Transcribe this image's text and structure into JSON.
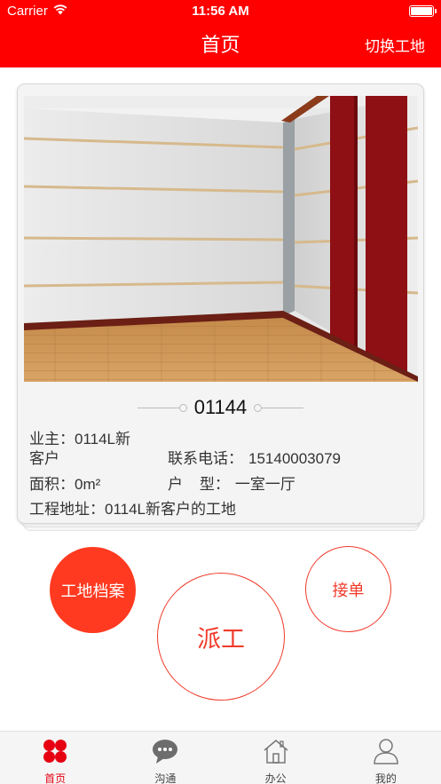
{
  "status_bar": {
    "carrier": "Carrier",
    "time": "11:56 AM"
  },
  "header": {
    "title": "首页",
    "switch_label": "切换工地"
  },
  "site": {
    "name": "01144",
    "owner_label": "业主：",
    "owner_value": "0114L新",
    "owner_value_cont": "客户",
    "phone_label": "联系电话：",
    "phone_value": "15140003079",
    "area_label": "面积：",
    "area_value": "0m²",
    "layout_label": "户    型：",
    "layout_value": "一室一厅",
    "address_label": "工程地址：",
    "address_value": "0114L新客户的工地"
  },
  "actions": {
    "archive": "工地档案",
    "dispatch": "派工",
    "accept": "接单"
  },
  "tabbar": {
    "items": [
      {
        "label": "首页",
        "icon": "home-grid-icon",
        "active": true
      },
      {
        "label": "沟通",
        "icon": "chat-bubble-icon",
        "active": false
      },
      {
        "label": "办公",
        "icon": "office-house-icon",
        "active": false
      },
      {
        "label": "我的",
        "icon": "user-profile-icon",
        "active": false
      }
    ]
  },
  "colors": {
    "primary": "#ff0000",
    "accent": "#f03a2a",
    "archive_button": "#ff3a20",
    "tab_active": "#e60012"
  }
}
